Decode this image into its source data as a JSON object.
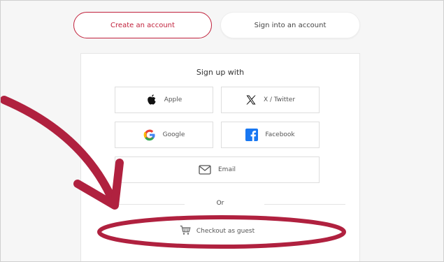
{
  "tabs": {
    "create_label": "Create an account",
    "signin_label": "Sign into an account"
  },
  "signup": {
    "heading": "Sign up with",
    "apple_label": "Apple",
    "x_label": "X / Twitter",
    "google_label": "Google",
    "facebook_label": "Facebook",
    "email_label": "Email",
    "or_label": "Or",
    "guest_label": "Checkout as guest"
  },
  "icons": {
    "apple": "apple-icon",
    "x": "x-twitter-icon",
    "google": "google-icon",
    "facebook": "facebook-icon",
    "email": "envelope-icon",
    "guest": "cart-icon"
  },
  "colors": {
    "accent": "#c1223c",
    "annotation": "#b0213f",
    "facebook": "#1877f2",
    "google_blue": "#4285f4",
    "google_red": "#ea4335",
    "google_yellow": "#fbbc05",
    "google_green": "#34a853"
  }
}
